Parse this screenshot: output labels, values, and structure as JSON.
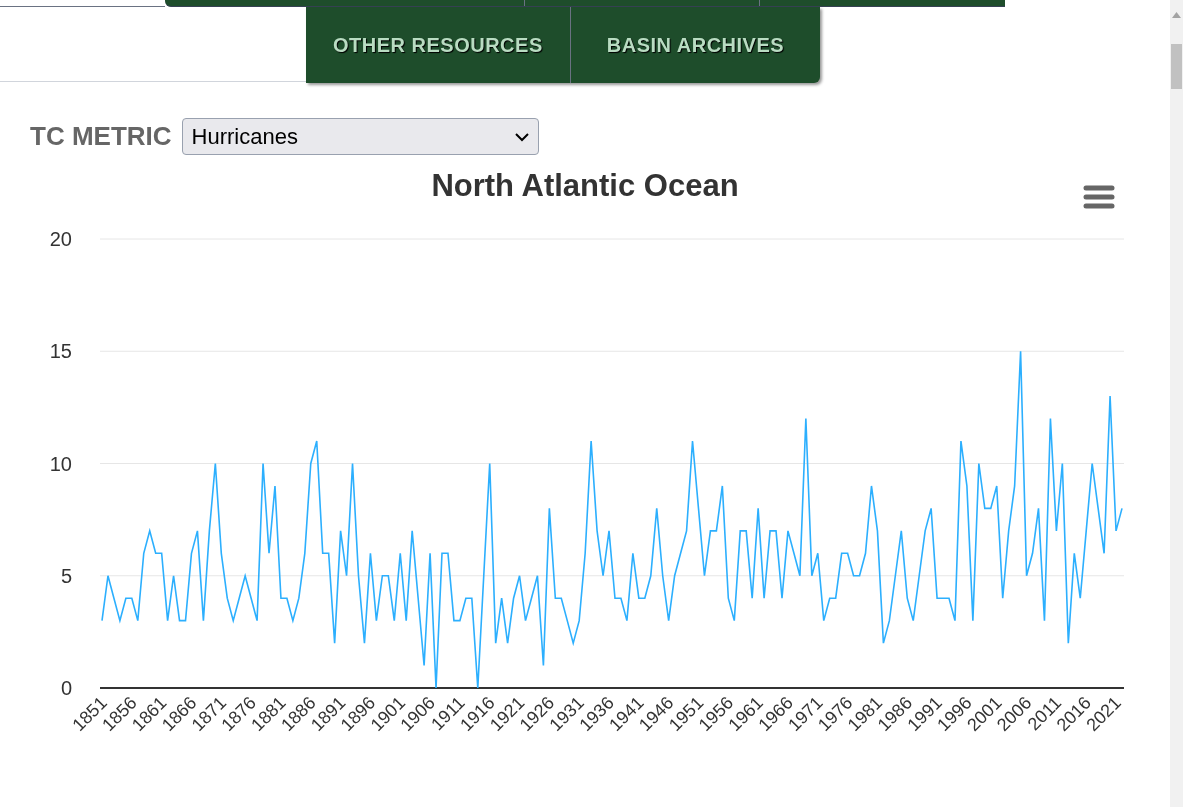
{
  "nav": {
    "tabs": [
      {
        "label": "OTHER RESOURCES"
      },
      {
        "label": "BASIN ARCHIVES"
      }
    ]
  },
  "tc_metric": {
    "label": "TC METRIC",
    "value": "Hurricanes"
  },
  "chart": {
    "chart_data": {
      "type": "line",
      "title": "North Atlantic Ocean",
      "x": [
        1851,
        1852,
        1853,
        1854,
        1855,
        1856,
        1857,
        1858,
        1859,
        1860,
        1861,
        1862,
        1863,
        1864,
        1865,
        1866,
        1867,
        1868,
        1869,
        1870,
        1871,
        1872,
        1873,
        1874,
        1875,
        1876,
        1877,
        1878,
        1879,
        1880,
        1881,
        1882,
        1883,
        1884,
        1885,
        1886,
        1887,
        1888,
        1889,
        1890,
        1891,
        1892,
        1893,
        1894,
        1895,
        1896,
        1897,
        1898,
        1899,
        1900,
        1901,
        1902,
        1903,
        1904,
        1905,
        1906,
        1907,
        1908,
        1909,
        1910,
        1911,
        1912,
        1913,
        1914,
        1915,
        1916,
        1917,
        1918,
        1919,
        1920,
        1921,
        1922,
        1923,
        1924,
        1925,
        1926,
        1927,
        1928,
        1929,
        1930,
        1931,
        1932,
        1933,
        1934,
        1935,
        1936,
        1937,
        1938,
        1939,
        1940,
        1941,
        1942,
        1943,
        1944,
        1945,
        1946,
        1947,
        1948,
        1949,
        1950,
        1951,
        1952,
        1953,
        1954,
        1955,
        1956,
        1957,
        1958,
        1959,
        1960,
        1961,
        1962,
        1963,
        1964,
        1965,
        1966,
        1967,
        1968,
        1969,
        1970,
        1971,
        1972,
        1973,
        1974,
        1975,
        1976,
        1977,
        1978,
        1979,
        1980,
        1981,
        1982,
        1983,
        1984,
        1985,
        1986,
        1987,
        1988,
        1989,
        1990,
        1991,
        1992,
        1993,
        1994,
        1995,
        1996,
        1997,
        1998,
        1999,
        2000,
        2001,
        2002,
        2003,
        2004,
        2005,
        2006,
        2007,
        2008,
        2009,
        2010,
        2011,
        2012,
        2013,
        2014,
        2015,
        2016,
        2017,
        2018,
        2019,
        2020,
        2021,
        2022
      ],
      "series": [
        {
          "color": "#2caffe",
          "values": [
            3,
            5,
            4,
            3,
            4,
            4,
            3,
            6,
            7,
            6,
            6,
            3,
            5,
            3,
            3,
            6,
            7,
            3,
            7,
            10,
            6,
            4,
            3,
            4,
            5,
            4,
            3,
            10,
            6,
            9,
            4,
            4,
            3,
            4,
            6,
            10,
            11,
            6,
            6,
            2,
            7,
            5,
            10,
            5,
            2,
            6,
            3,
            5,
            5,
            3,
            6,
            3,
            7,
            4,
            1,
            6,
            0,
            6,
            6,
            3,
            3,
            4,
            4,
            0,
            5,
            10,
            2,
            4,
            2,
            4,
            5,
            3,
            4,
            5,
            1,
            8,
            4,
            4,
            3,
            2,
            3,
            6,
            11,
            7,
            5,
            7,
            4,
            4,
            3,
            6,
            4,
            4,
            5,
            8,
            5,
            3,
            5,
            6,
            7,
            11,
            8,
            5,
            7,
            7,
            9,
            4,
            3,
            7,
            7,
            4,
            8,
            4,
            7,
            7,
            4,
            7,
            6,
            5,
            12,
            5,
            6,
            3,
            4,
            4,
            6,
            6,
            5,
            5,
            6,
            9,
            7,
            2,
            3,
            5,
            7,
            4,
            3,
            5,
            7,
            8,
            4,
            4,
            4,
            3,
            11,
            9,
            3,
            10,
            8,
            8,
            9,
            4,
            7,
            9,
            15,
            5,
            6,
            8,
            3,
            12,
            7,
            10,
            2,
            6,
            4,
            7,
            10,
            8,
            6,
            13,
            7,
            8
          ]
        }
      ],
      "xlim": [
        1851,
        2022
      ],
      "grid": true,
      "ylim": [
        0,
        20
      ],
      "yticks": [
        0,
        5,
        10,
        15,
        20
      ],
      "xticks": [
        1851,
        1856,
        1861,
        1866,
        1871,
        1876,
        1881,
        1886,
        1891,
        1896,
        1901,
        1906,
        1911,
        1916,
        1921,
        1926,
        1931,
        1936,
        1941,
        1946,
        1951,
        1956,
        1961,
        1966,
        1971,
        1976,
        1981,
        1986,
        1991,
        1996,
        2001,
        2006,
        2011,
        2016,
        2021
      ]
    }
  }
}
